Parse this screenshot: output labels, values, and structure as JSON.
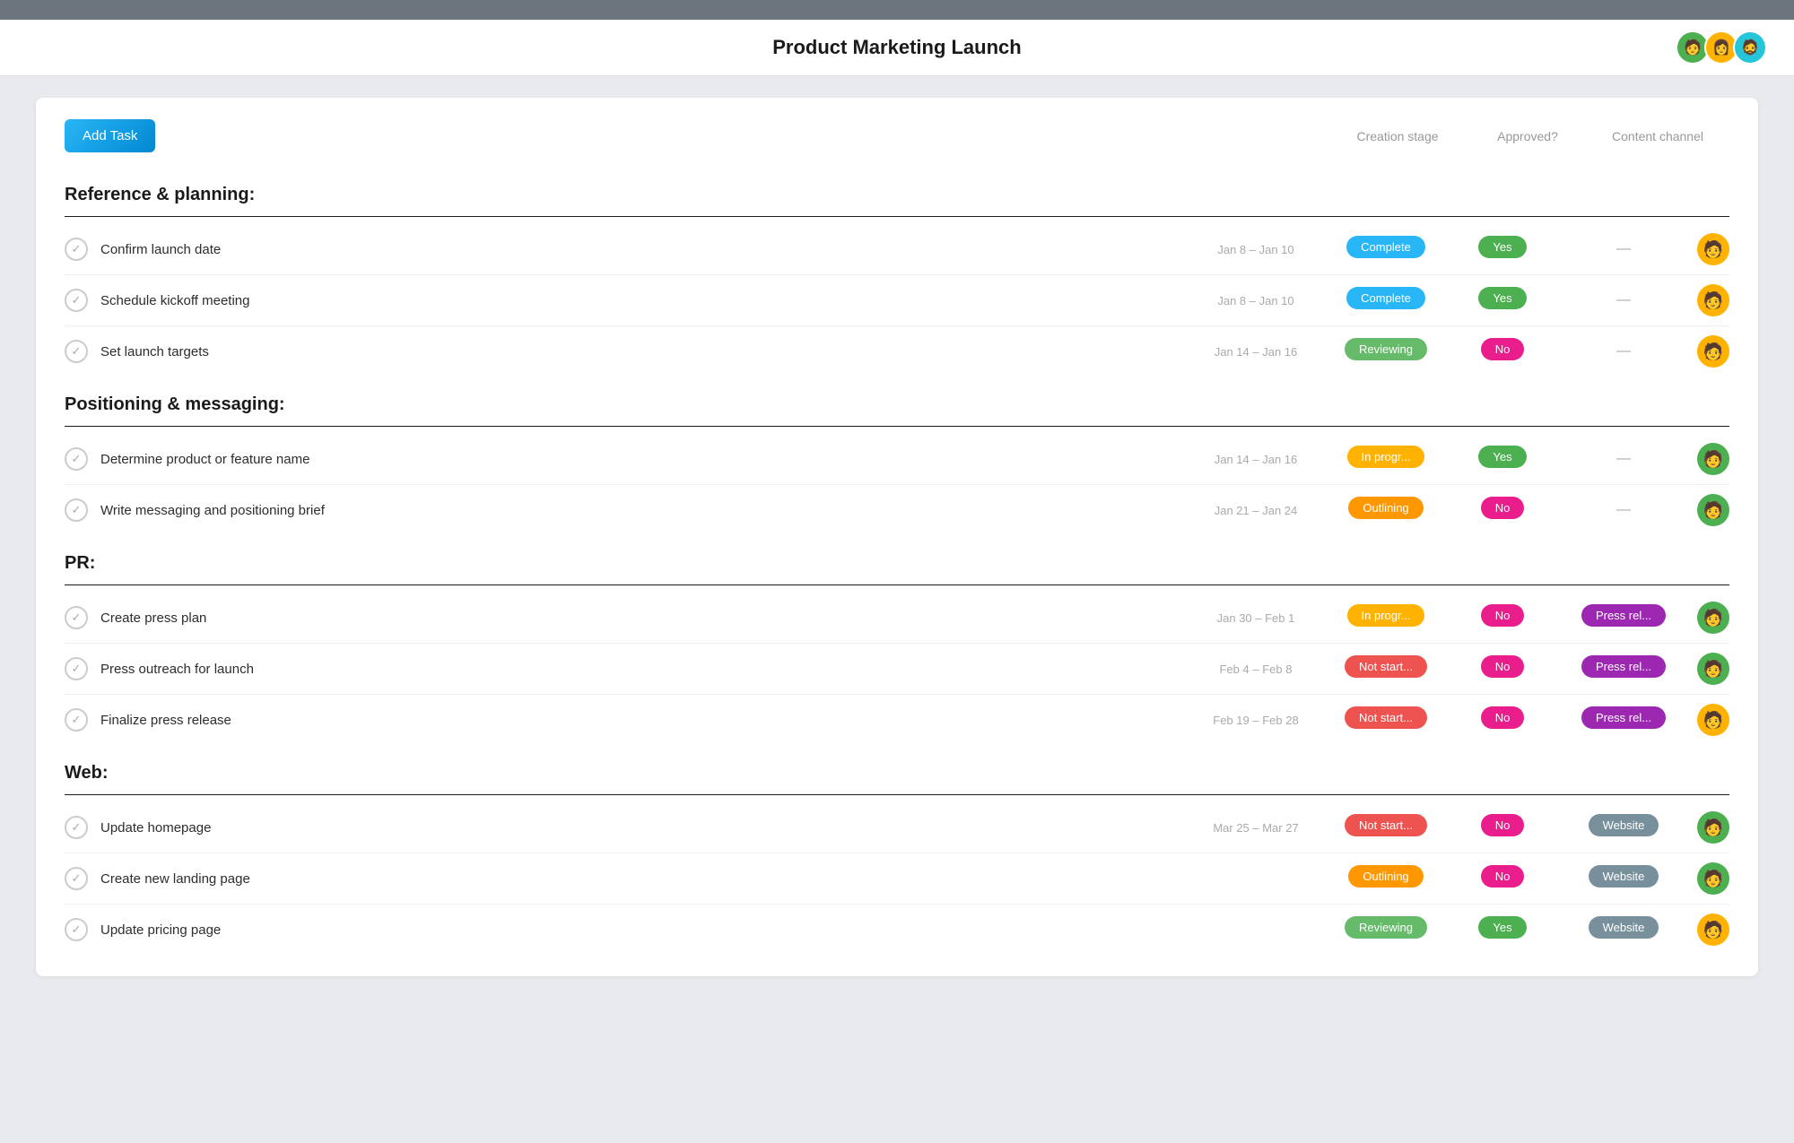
{
  "app": {
    "title": "Product Marketing Launch"
  },
  "header": {
    "title": "Product Marketing Launch",
    "avatars": [
      {
        "id": "avatar-1",
        "color": "#4caf50",
        "emoji": "🧑"
      },
      {
        "id": "avatar-2",
        "color": "#ffb300",
        "emoji": "👩"
      },
      {
        "id": "avatar-3",
        "color": "#26c6da",
        "emoji": "🧔"
      }
    ]
  },
  "toolbar": {
    "add_task_label": "Add Task",
    "col_creation": "Creation stage",
    "col_approved": "Approved?",
    "col_channel": "Content channel"
  },
  "sections": [
    {
      "id": "reference-planning",
      "title": "Reference & planning:",
      "tasks": [
        {
          "name": "Confirm launch date",
          "dates": "Jan 8 – Jan 10",
          "stage": "Complete",
          "stage_type": "complete",
          "approved": "Yes",
          "approved_type": "yes",
          "channel": "—",
          "channel_type": "dash",
          "avatar_emoji": "🧑",
          "avatar_color": "#ffb300"
        },
        {
          "name": "Schedule kickoff meeting",
          "dates": "Jan 8 – Jan 10",
          "stage": "Complete",
          "stage_type": "complete",
          "approved": "Yes",
          "approved_type": "yes",
          "channel": "—",
          "channel_type": "dash",
          "avatar_emoji": "🧑",
          "avatar_color": "#ffb300"
        },
        {
          "name": "Set launch targets",
          "dates": "Jan 14 – Jan 16",
          "stage": "Reviewing",
          "stage_type": "reviewing",
          "approved": "No",
          "approved_type": "no",
          "channel": "—",
          "channel_type": "dash",
          "avatar_emoji": "🧑",
          "avatar_color": "#ffb300"
        }
      ]
    },
    {
      "id": "positioning-messaging",
      "title": "Positioning & messaging:",
      "tasks": [
        {
          "name": "Determine product or feature name",
          "dates": "Jan 14 – Jan 16",
          "stage": "In progr...",
          "stage_type": "inprogress",
          "approved": "Yes",
          "approved_type": "yes",
          "channel": "—",
          "channel_type": "dash",
          "avatar_emoji": "🧑",
          "avatar_color": "#4caf50"
        },
        {
          "name": "Write messaging and positioning brief",
          "dates": "Jan 21 – Jan 24",
          "stage": "Outlining",
          "stage_type": "outlining",
          "approved": "No",
          "approved_type": "no",
          "channel": "—",
          "channel_type": "dash",
          "avatar_emoji": "🧑",
          "avatar_color": "#4caf50"
        }
      ]
    },
    {
      "id": "pr",
      "title": "PR:",
      "tasks": [
        {
          "name": "Create press plan",
          "dates": "Jan 30 – Feb 1",
          "stage": "In progr...",
          "stage_type": "inprogress",
          "approved": "No",
          "approved_type": "no",
          "channel": "Press rel...",
          "channel_type": "pressrel",
          "avatar_emoji": "🧑",
          "avatar_color": "#4caf50"
        },
        {
          "name": "Press outreach for launch",
          "dates": "Feb 4 – Feb 8",
          "stage": "Not start...",
          "stage_type": "notstart",
          "approved": "No",
          "approved_type": "no",
          "channel": "Press rel...",
          "channel_type": "pressrel",
          "avatar_emoji": "🧑",
          "avatar_color": "#4caf50"
        },
        {
          "name": "Finalize press release",
          "dates": "Feb 19 – Feb 28",
          "stage": "Not start...",
          "stage_type": "notstart",
          "approved": "No",
          "approved_type": "no",
          "channel": "Press rel...",
          "channel_type": "pressrel",
          "avatar_emoji": "🧑",
          "avatar_color": "#ffb300"
        }
      ]
    },
    {
      "id": "web",
      "title": "Web:",
      "tasks": [
        {
          "name": "Update homepage",
          "dates": "Mar 25 – Mar 27",
          "stage": "Not start...",
          "stage_type": "notstart",
          "approved": "No",
          "approved_type": "no",
          "channel": "Website",
          "channel_type": "website",
          "avatar_emoji": "🧑",
          "avatar_color": "#4caf50"
        },
        {
          "name": "Create new landing page",
          "dates": "",
          "stage": "Outlining",
          "stage_type": "outlining",
          "approved": "No",
          "approved_type": "no",
          "channel": "Website",
          "channel_type": "website",
          "avatar_emoji": "🧑",
          "avatar_color": "#4caf50"
        },
        {
          "name": "Update pricing page",
          "dates": "",
          "stage": "Reviewing",
          "stage_type": "reviewing",
          "approved": "Yes",
          "approved_type": "yes",
          "channel": "Website",
          "channel_type": "website",
          "avatar_emoji": "🧑",
          "avatar_color": "#ffb300"
        }
      ]
    }
  ]
}
